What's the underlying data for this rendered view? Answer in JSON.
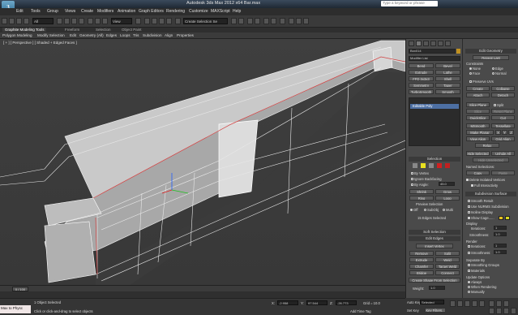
{
  "titlebar": {
    "title": "Autodesk 3ds Max 2012 x64    Bar.max",
    "search_placeholder": "Type a keyword or phrase"
  },
  "app_icon": "3ds-max-icon",
  "menu": [
    "Edit",
    "Tools",
    "Group",
    "Views",
    "Create",
    "Modifiers",
    "Animation",
    "Graph Editors",
    "Rendering",
    "Customize",
    "MAXScript",
    "Help"
  ],
  "toolbar": {
    "selection_filter": "All",
    "view_dropdown": "View",
    "named_selection": "Create Selection Se"
  },
  "ribbon": {
    "tabs": [
      "Graphite Modeling Tools",
      "Freeform",
      "Selection",
      "Object Paint"
    ],
    "subtabs": [
      "Polygon Modeling",
      "Modify Selection",
      "Edit",
      "Geometry (All)",
      "Edges",
      "Loops",
      "Tris",
      "Subdivision",
      "Align",
      "Properties"
    ]
  },
  "viewport": {
    "label": "[ + ] [ Perspective ] [ Shaded + Edged Faces ]"
  },
  "command_panel": {
    "object_name": "Box014",
    "modifier_list": "Modifier List",
    "modifier_buttons": [
      "Bend",
      "Bevel",
      "Extrude",
      "Lathe",
      "FFD 3x3x3",
      "Shell",
      "Symmetry",
      "Taper",
      "TurboSmooth",
      "Smooth"
    ],
    "stack_item": "Editable Poly",
    "selection_title": "Selection",
    "by_vertex": "By Vertex",
    "ignore_backfacing": "Ignore Backfacing",
    "by_angle": "By Angle:",
    "angle_value": "45.0",
    "shrink": "Shrink",
    "grow": "Grow",
    "ring": "Ring",
    "loop": "Loop",
    "preview_selection": "Preview Selection",
    "preview_options": [
      "Off",
      "SubObj",
      "Multi"
    ],
    "selected_count": "15 Edges Selected",
    "soft_selection": "Soft Selection",
    "edit_edges": "Edit Edges",
    "insert_vertex": "Insert Vertex",
    "edge_buttons": [
      "Remove",
      "Split",
      "Extrude",
      "Weld",
      "Chamfer",
      "Target Weld",
      "Bridge",
      "Connect"
    ],
    "create_shape": "Create Shape From Selection",
    "weight_label": "Weight:",
    "weight_value": "1.0"
  },
  "edit_geometry": {
    "title": "Edit Geometry",
    "repeat_last": "Repeat Last",
    "constraints": "Constraints",
    "constraint_opts": [
      "None",
      "Edge",
      "Face",
      "Normal"
    ],
    "preserve_uvs": "Preserve UVs",
    "create": "Create",
    "collapse": "Collapse",
    "attach": "Attach",
    "detach": "Detach",
    "slice_plane": "Slice Plane",
    "split": "Split",
    "slice": "Slice",
    "reset_plane": "Reset Plane",
    "quickslice": "QuickSlice",
    "cut": "Cut",
    "msmooth": "MSmooth",
    "tessellate": "Tessellate",
    "make_planar": "Make Planar",
    "xyz": [
      "X",
      "Y",
      "Z"
    ],
    "view_align": "View Align",
    "grid_align": "Grid Align",
    "relax": "Relax",
    "hide_selected": "Hide Selected",
    "unhide_all": "Unhide All",
    "hide_unselected": "Hide Unselected",
    "named_selections": "Named Selections:",
    "copy": "Copy",
    "paste": "Paste",
    "delete_isolated": "Delete Isolated Vertices",
    "full_interactivity": "Full Interactivity",
    "subdivision_surface": "Subdivision Surface",
    "smooth_result": "Smooth Result",
    "use_nurms": "Use NURMS Subdivision",
    "isoline": "Isoline Display",
    "show_cage": "Show Cage......",
    "display": "Display",
    "iterations_label": "Iterations:",
    "iterations_value": "1",
    "smoothness_label": "Smoothness:",
    "smoothness_value": "1.0",
    "render": "Render",
    "separate_by": "Separate By",
    "smoothing_groups": "Smoothing Groups",
    "materials": "Materials",
    "update_options": "Update Options",
    "always": "Always",
    "when_rendering": "When Rendering",
    "manually": "Manually",
    "cage_color1": "#e8c020",
    "cage_color2": "#d8d820"
  },
  "timeline": {
    "frame": "0 / 100",
    "ticks": [
      "0",
      "10",
      "20",
      "30",
      "40",
      "50",
      "60",
      "70",
      "80",
      "90",
      "100"
    ]
  },
  "status": {
    "listener": "Max to Physc",
    "objects_selected": "1 Object Selected",
    "prompt": "Click or click-and-drag to select objects",
    "x_label": "X:",
    "x_value": "-2.958",
    "y_label": "Y:",
    "y_value": "97.544",
    "z_label": "Z:",
    "z_value": "-26.773",
    "grid": "Grid = 10.0",
    "add_time_tag": "Add Time Tag",
    "auto_key": "Auto Key",
    "selected": "Selected",
    "set_key": "Set Key",
    "key_filters": "Key Filters..."
  }
}
